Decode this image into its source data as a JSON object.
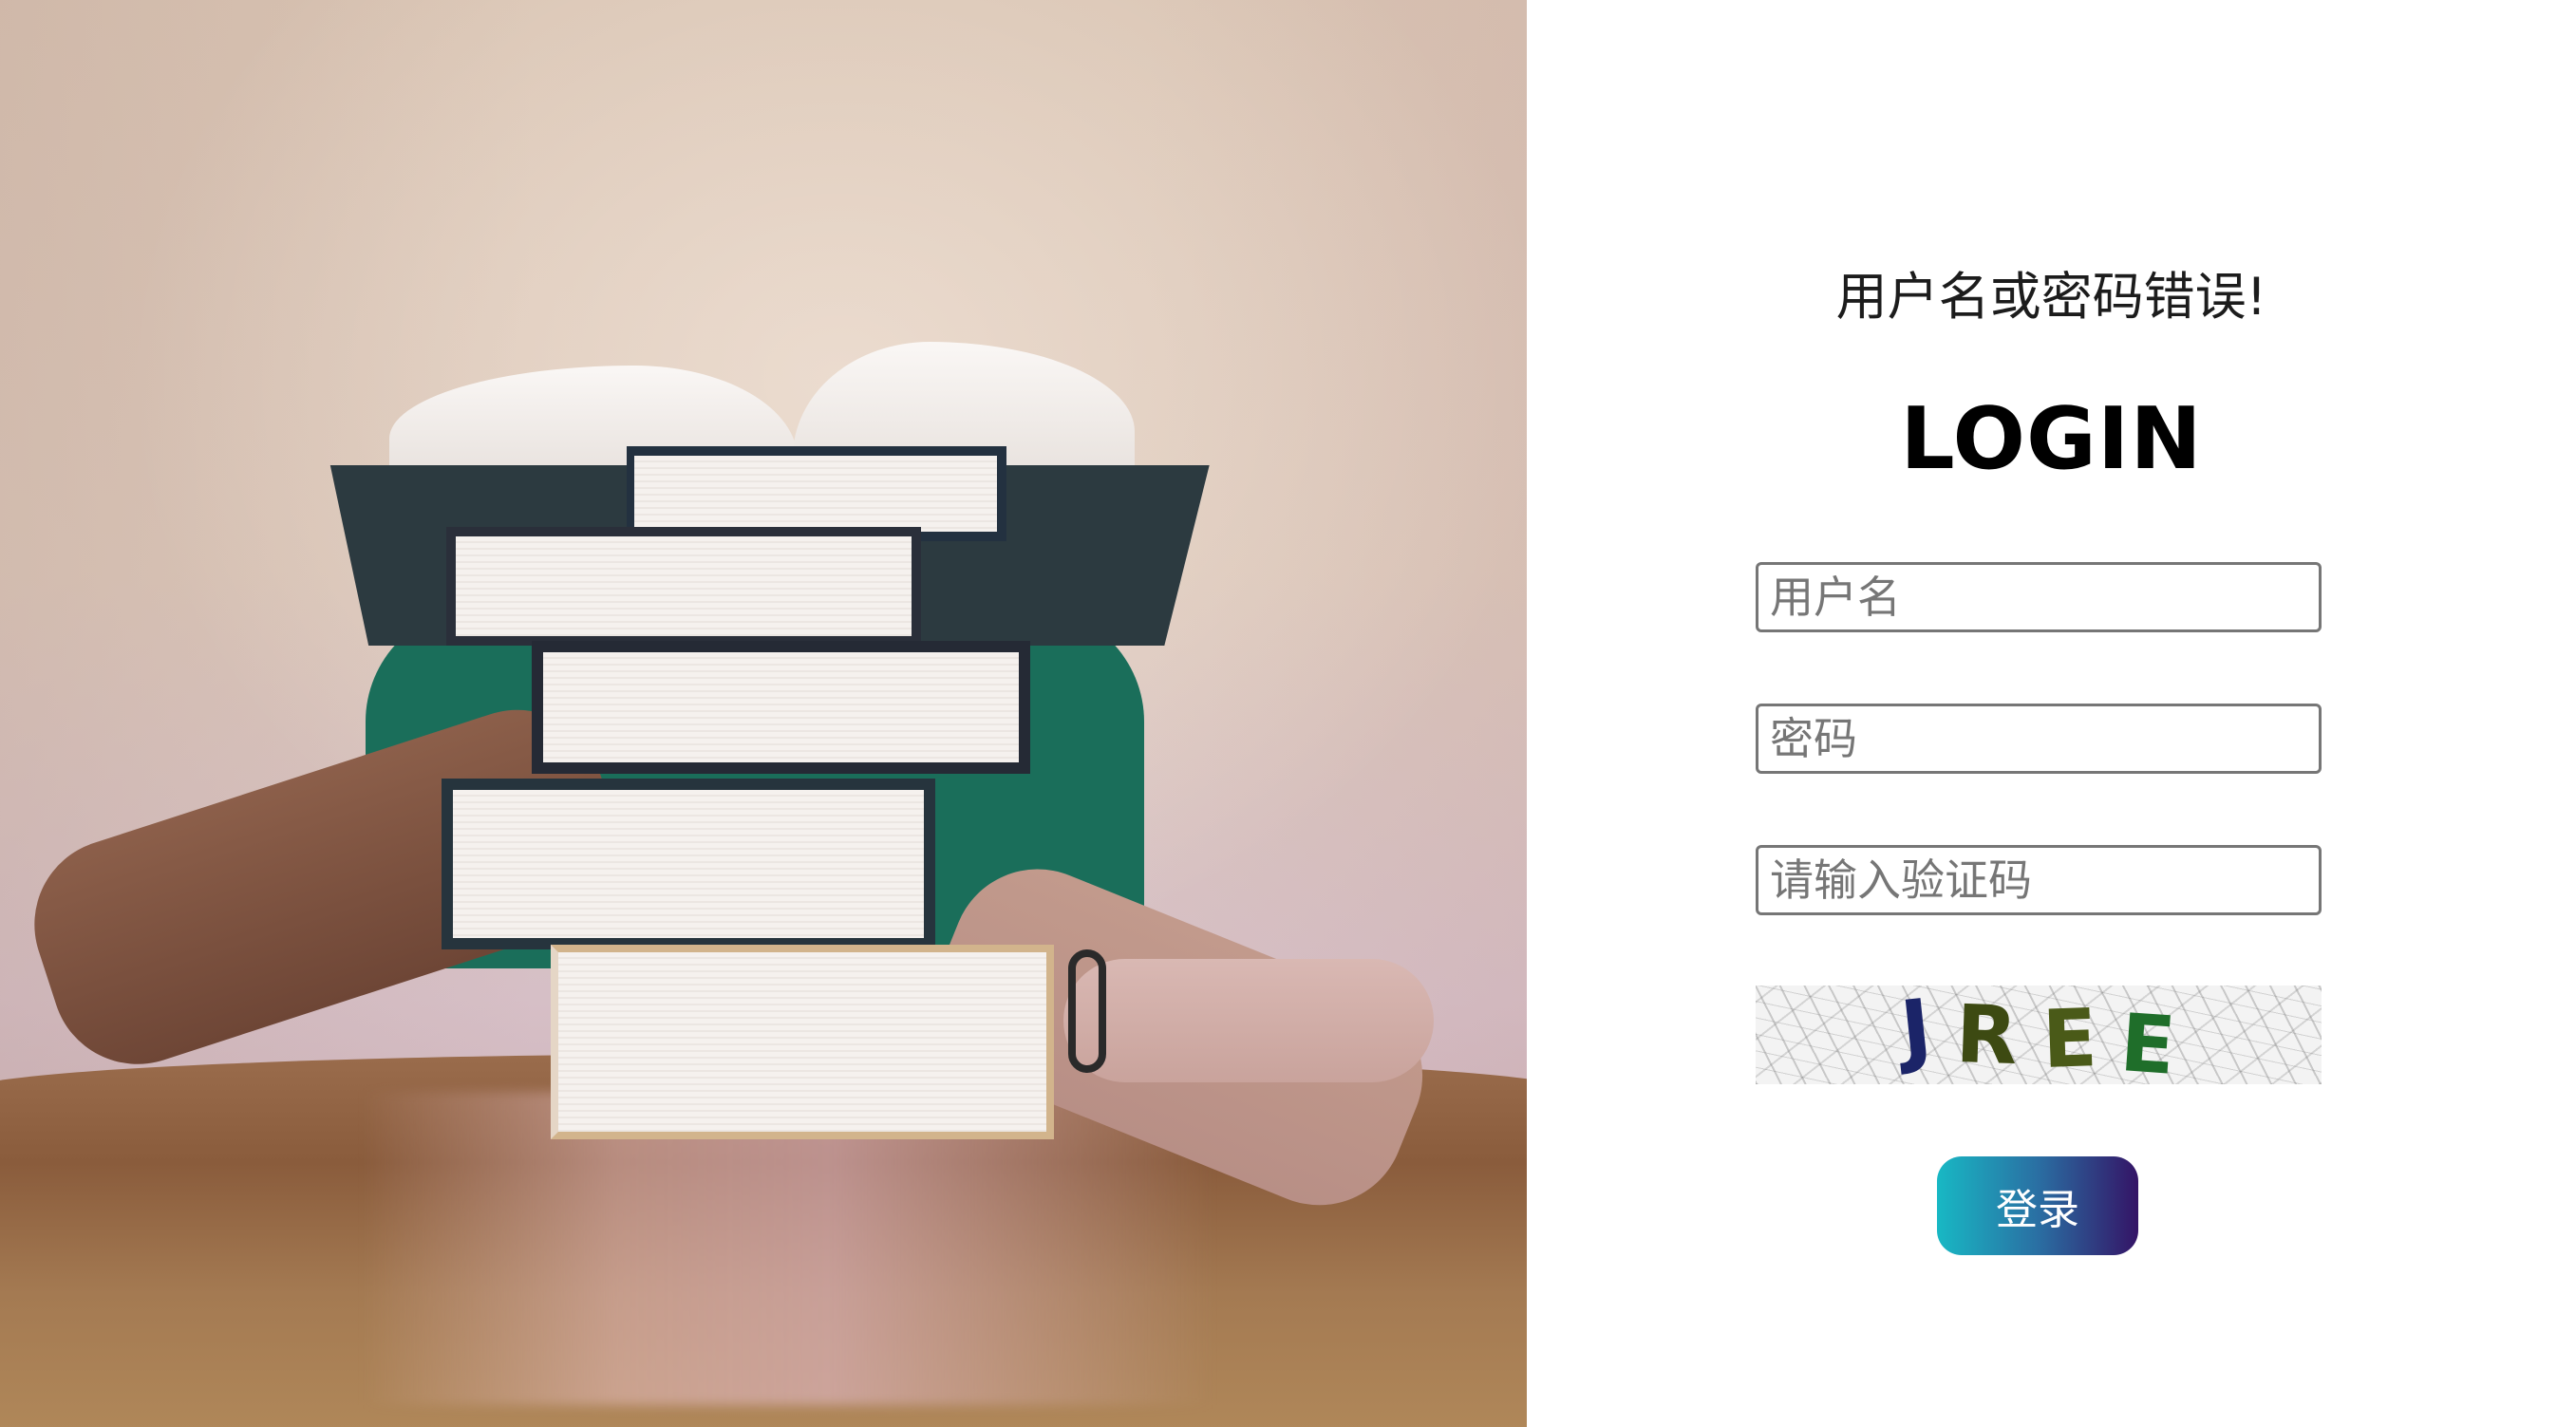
{
  "left_panel": {
    "image_description_icon": "books-stack-photo-icon"
  },
  "login_form": {
    "error_message": "用户名或密码错误!",
    "title": "LOGIN",
    "username_placeholder": "用户名",
    "password_placeholder": "密码",
    "captcha_placeholder": "请输入验证码",
    "captcha_text": [
      "J",
      "R",
      "E",
      "E"
    ],
    "submit_label": "登录"
  },
  "colors": {
    "button_gradient_start": "#18b8c4",
    "button_gradient_end": "#341466",
    "input_border": "#767676"
  }
}
